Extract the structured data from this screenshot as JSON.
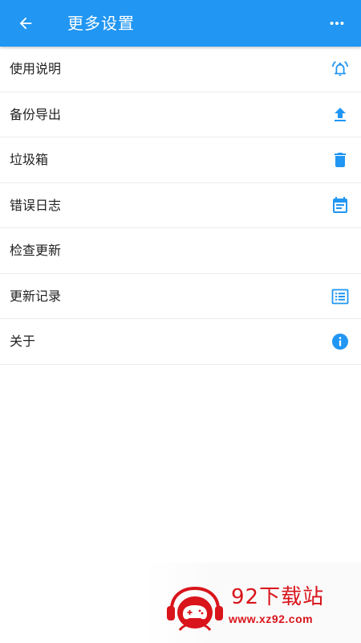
{
  "appbar": {
    "title": "更多设置",
    "back_icon": "arrow-back-icon",
    "more_icon": "more-horiz-icon",
    "color": "#2196f3"
  },
  "menu": {
    "items": [
      {
        "label": "使用说明",
        "icon": "alarm-bell-icon"
      },
      {
        "label": "备份导出",
        "icon": "upload-icon"
      },
      {
        "label": "垃圾箱",
        "icon": "trash-icon"
      },
      {
        "label": "错误日志",
        "icon": "calendar-note-icon"
      },
      {
        "label": "检查更新",
        "icon": ""
      },
      {
        "label": "更新记录",
        "icon": "list-icon"
      },
      {
        "label": "关于",
        "icon": "info-icon"
      }
    ],
    "icon_color": "#2196f3"
  },
  "watermark": {
    "title": "92下载站",
    "url": "www.xz92.com",
    "color": "#d9141b"
  }
}
